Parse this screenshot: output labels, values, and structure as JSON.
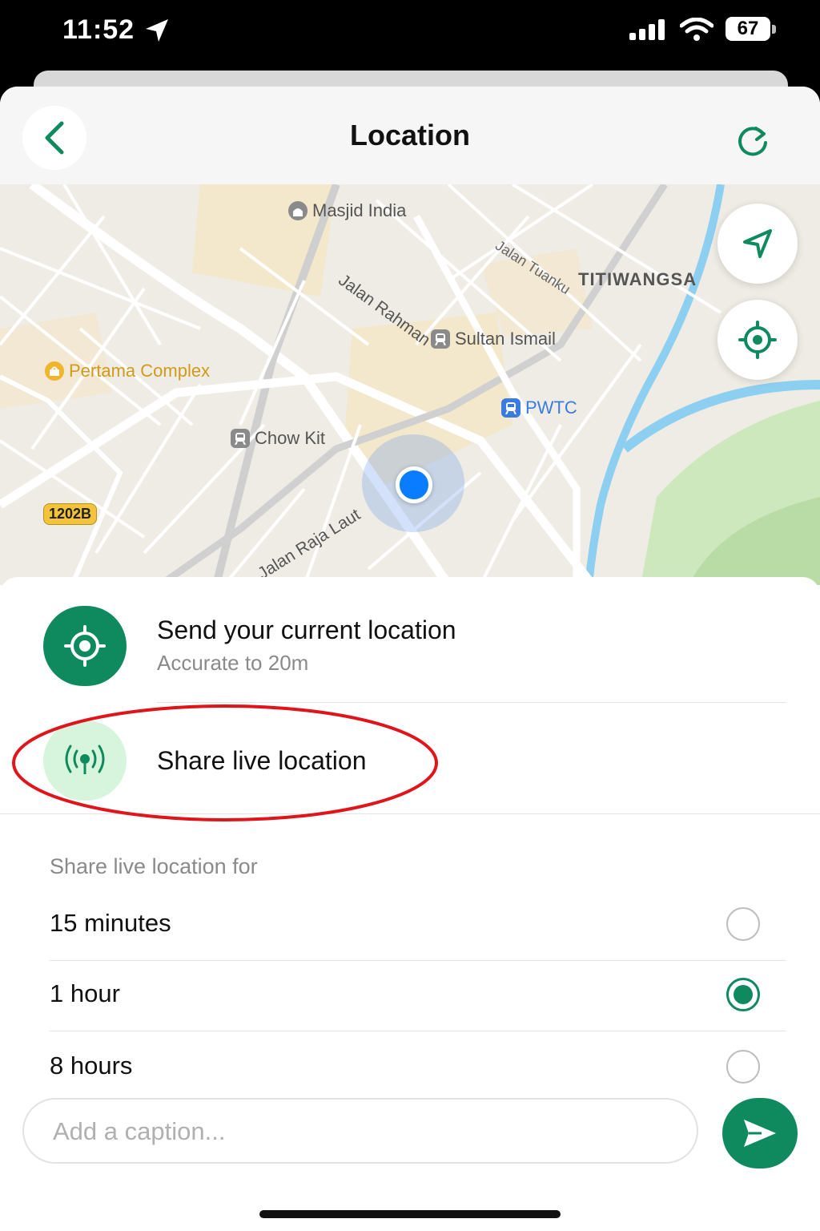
{
  "status_bar": {
    "time": "11:52",
    "battery": "67"
  },
  "nav": {
    "title": "Location"
  },
  "map": {
    "labels": {
      "masjid_india": "Masjid India",
      "jalan_rahman": "Jalan Rahman",
      "jalan_tuanku": "Jalan Tuanku",
      "titiwangsa": "TITIWANGSA",
      "sultan_ismail": "Sultan Ismail",
      "pertama_complex": "Pertama Complex",
      "pwtc": "PWTC",
      "chow_kit": "Chow Kit",
      "route_1202b": "1202B",
      "jalan_raja_laut": "Jalan Raja Laut"
    }
  },
  "options": {
    "send_current": {
      "title": "Send your current location",
      "subtitle": "Accurate to 20m"
    },
    "share_live": {
      "title": "Share live location"
    }
  },
  "durations": {
    "header": "Share live location for",
    "items": [
      {
        "label": "15 minutes",
        "selected": false
      },
      {
        "label": "1 hour",
        "selected": true
      },
      {
        "label": "8 hours",
        "selected": false
      }
    ]
  },
  "caption": {
    "placeholder": "Add a caption..."
  },
  "colors": {
    "brand_green": "#0f8a5f",
    "light_green": "#d6f5dc",
    "user_dot": "#0a7cff",
    "annotation_red": "#e0151b"
  }
}
